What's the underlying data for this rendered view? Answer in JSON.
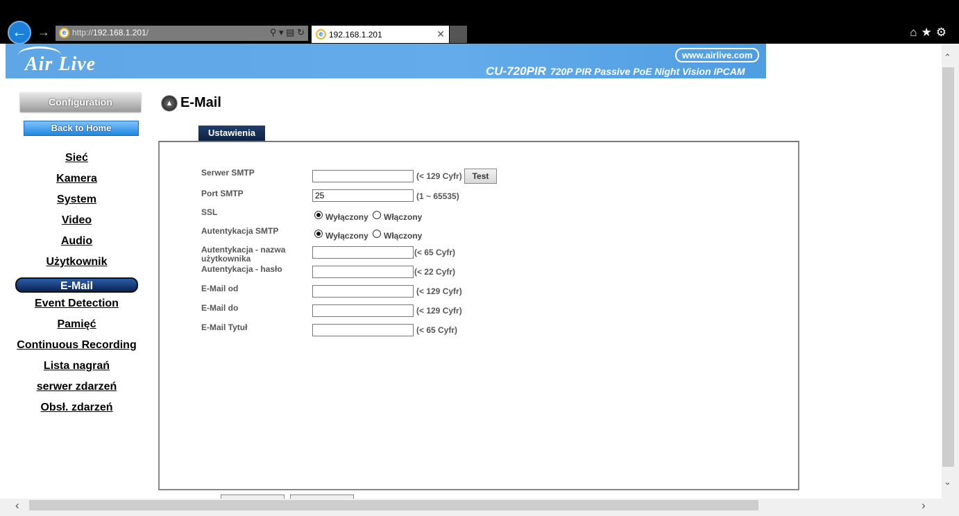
{
  "browser": {
    "url_prefix": "http://",
    "url_host": "192.168.1.201",
    "url_suffix": "/",
    "tab_title": "192.168.1.201"
  },
  "banner": {
    "logo": "Air Live",
    "site": "www.airlive.com",
    "model": "CU-720PIR",
    "model_desc": "720P PIR Passive PoE Night Vision IPCAM"
  },
  "sidebar": {
    "config_label": "Configuration",
    "home_label": "Back to Home",
    "items": [
      {
        "label": "Sieć"
      },
      {
        "label": "Kamera"
      },
      {
        "label": "System"
      },
      {
        "label": "Video"
      },
      {
        "label": "Audio"
      },
      {
        "label": "Użytkownik"
      },
      {
        "label": "E-Mail",
        "active": true
      },
      {
        "label": "Event Detection"
      },
      {
        "label": "Pamięć"
      },
      {
        "label": "Continuous Recording"
      },
      {
        "label": "Lista nagrań"
      },
      {
        "label": "serwer zdarzeń"
      },
      {
        "label": "Obsł. zdarzeń"
      }
    ]
  },
  "page": {
    "title": "E-Mail",
    "tab_label": "Ustawienia"
  },
  "form": {
    "smtp_server": {
      "label": "Serwer SMTP",
      "value": "",
      "hint": "(< 129 Cyfr)",
      "test_label": "Test"
    },
    "smtp_port": {
      "label": "Port SMTP",
      "value": "25",
      "hint": "(1 ~ 65535)"
    },
    "ssl": {
      "label": "SSL",
      "off_label": "Wyłączony",
      "on_label": "Włączony",
      "selected": "off"
    },
    "smtp_auth": {
      "label": "Autentykacja SMTP",
      "off_label": "Wyłączony",
      "on_label": "Włączony",
      "selected": "off"
    },
    "auth_user": {
      "label_line1": "Autentykacja - nazwa",
      "label_line2": "użytkownika",
      "value": "",
      "hint": "(< 65 Cyfr)"
    },
    "auth_pass": {
      "label": "Autentykacja - hasło",
      "value": "",
      "hint": "(< 22 Cyfr)"
    },
    "mail_from": {
      "label": "E-Mail od",
      "value": "",
      "hint": "(< 129 Cyfr)"
    },
    "mail_to": {
      "label": "E-Mail do",
      "value": "",
      "hint": "(< 129 Cyfr)"
    },
    "mail_subject": {
      "label": "E-Mail Tytuł",
      "value": "",
      "hint": "(< 65 Cyfr)"
    }
  }
}
